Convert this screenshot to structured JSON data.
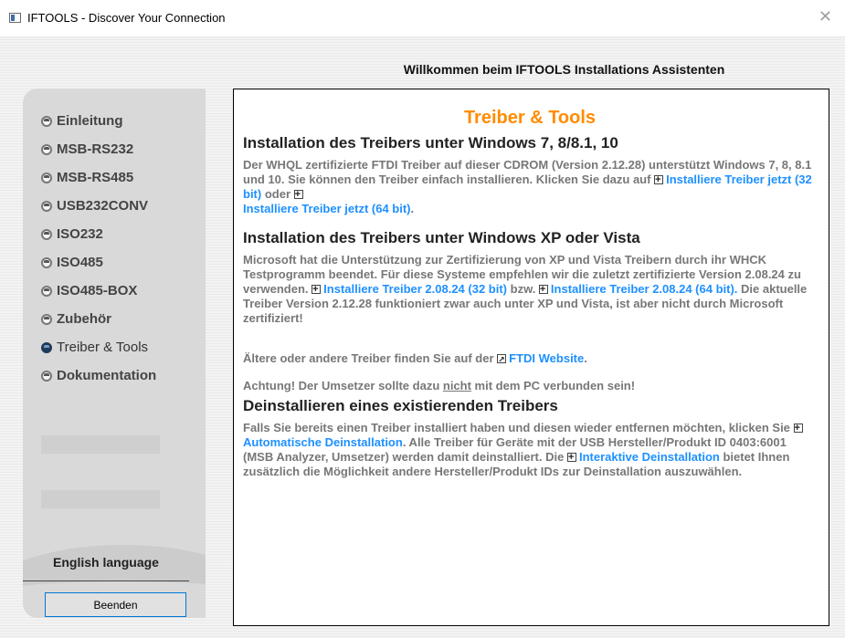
{
  "window": {
    "title": "IFTOOLS - Discover Your Connection"
  },
  "header": {
    "title": "Willkommen beim IFTOOLS Installations Assistenten"
  },
  "sidebar": {
    "items": [
      {
        "label": "Einleitung"
      },
      {
        "label": "MSB-RS232"
      },
      {
        "label": "MSB-RS485"
      },
      {
        "label": "USB232CONV"
      },
      {
        "label": "ISO232"
      },
      {
        "label": "ISO485"
      },
      {
        "label": "ISO485-BOX"
      },
      {
        "label": "Zubehör"
      },
      {
        "label": "Treiber & Tools",
        "selected": true
      },
      {
        "label": "Dokumentation"
      }
    ],
    "language_link": "English language",
    "quit_button": "Beenden"
  },
  "content": {
    "title": "Treiber & Tools",
    "sections": [
      {
        "heading": "Installation des Treibers unter Windows 7, 8/8.1, 10",
        "text_1": "Der WHQL zertifizierte FTDI Treiber auf dieser CDROM (Version 2.12.28) unterstützt Windows 7, 8, 8.1 und 10. Sie können den Treiber einfach installieren. Klicken Sie dazu auf ",
        "link_1": "Installiere Treiber jetzt (32 bit)",
        "text_2": " oder ",
        "link_2": "Installiere Treiber jetzt (64 bit)",
        "text_3": "."
      },
      {
        "heading": "Installation des Treibers unter Windows XP oder Vista",
        "text_1": "Microsoft hat die Unterstützung zur Zertifizierung von XP und Vista Treibern durch ihr WHCK Testprogramm beendet. Für diese Systeme empfehlen wir die zuletzt zertifizierte Version 2.08.24 zu verwenden. ",
        "link_1": "Installiere Treiber 2.08.24 (32 bit)",
        "text_2": " bzw. ",
        "link_2": "Installiere Treiber 2.08.24 (64 bit).",
        "text_3": " Die aktuelle Treiber Version 2.12.28 funktioniert zwar auch unter XP und Vista, ist aber nicht durch Microsoft zertifiziert!",
        "older_text": "Ältere oder andere Treiber finden Sie auf der ",
        "older_link": "FTDI Website",
        "older_end": ".",
        "warning_1": "Achtung! Der Umsetzer sollte dazu ",
        "warning_not": "nicht",
        "warning_2": " mit dem PC verbunden sein!"
      },
      {
        "heading": "Deinstallieren eines existierenden Treibers",
        "text_1": "Falls Sie bereits einen Treiber installiert haben und diesen wieder entfernen möchten, klicken Sie ",
        "link_1": "Automatische Deinstallation",
        "text_2": ". Alle Treiber für Geräte mit der USB Hersteller/Produkt ID 0403:6001 (MSB Analyzer, Umsetzer) werden damit deinstalliert. Die ",
        "link_2": "Interaktive Deinstallation",
        "text_3": " bietet Ihnen zusätzlich die Möglichkeit andere Hersteller/Produkt IDs zur Deinstallation auszuwählen."
      }
    ]
  },
  "colors": {
    "accent": "#ff8c00",
    "link": "#1e90ff",
    "body_text": "#777777"
  }
}
